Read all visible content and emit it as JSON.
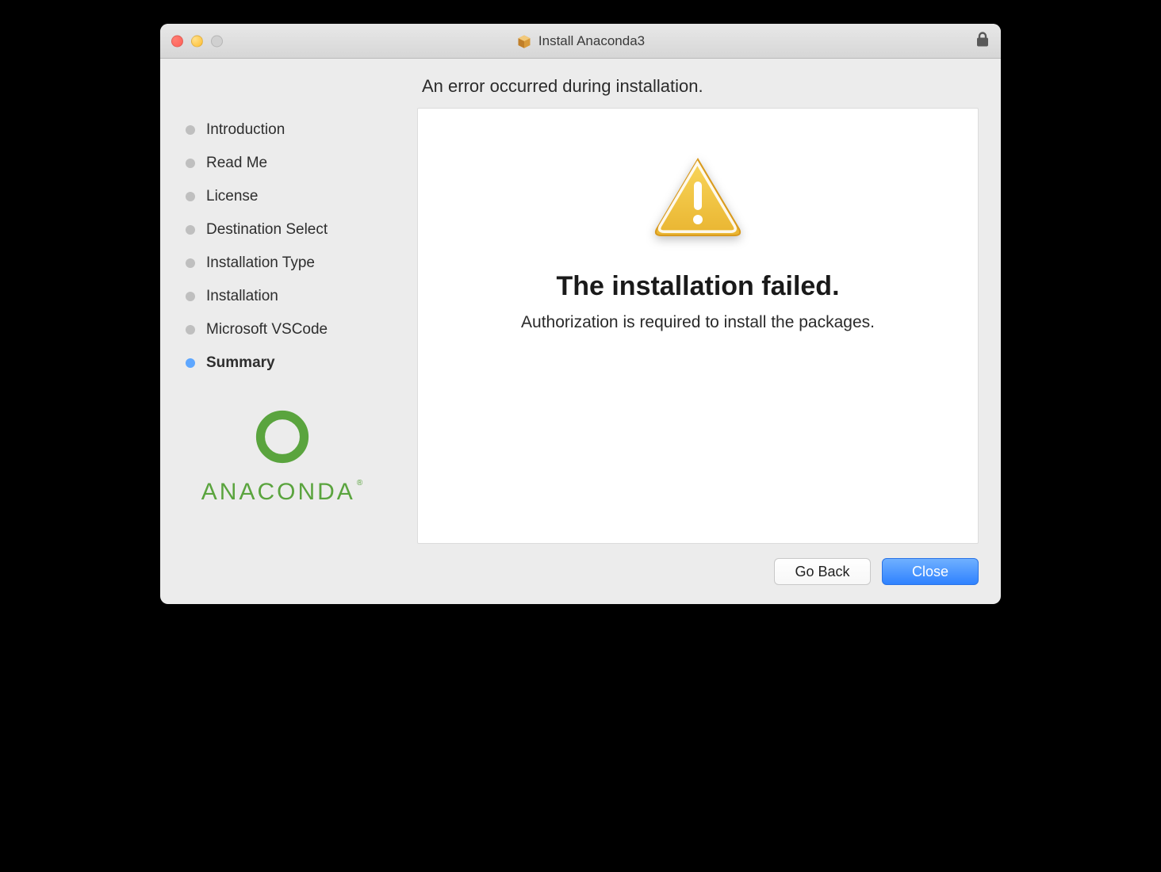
{
  "titlebar": {
    "title": "Install Anaconda3"
  },
  "heading": "An error occurred during installation.",
  "sidebar": {
    "steps": [
      {
        "label": "Introduction",
        "active": false
      },
      {
        "label": "Read Me",
        "active": false
      },
      {
        "label": "License",
        "active": false
      },
      {
        "label": "Destination Select",
        "active": false
      },
      {
        "label": "Installation Type",
        "active": false
      },
      {
        "label": "Installation",
        "active": false
      },
      {
        "label": "Microsoft VSCode",
        "active": false
      },
      {
        "label": "Summary",
        "active": true
      }
    ],
    "brand_word": "ANACONDA",
    "brand_color": "#5aa43e"
  },
  "panel": {
    "title": "The installation failed.",
    "message": "Authorization is required to install the packages.",
    "icon": "warning"
  },
  "footer": {
    "back_label": "Go Back",
    "primary_label": "Close"
  }
}
